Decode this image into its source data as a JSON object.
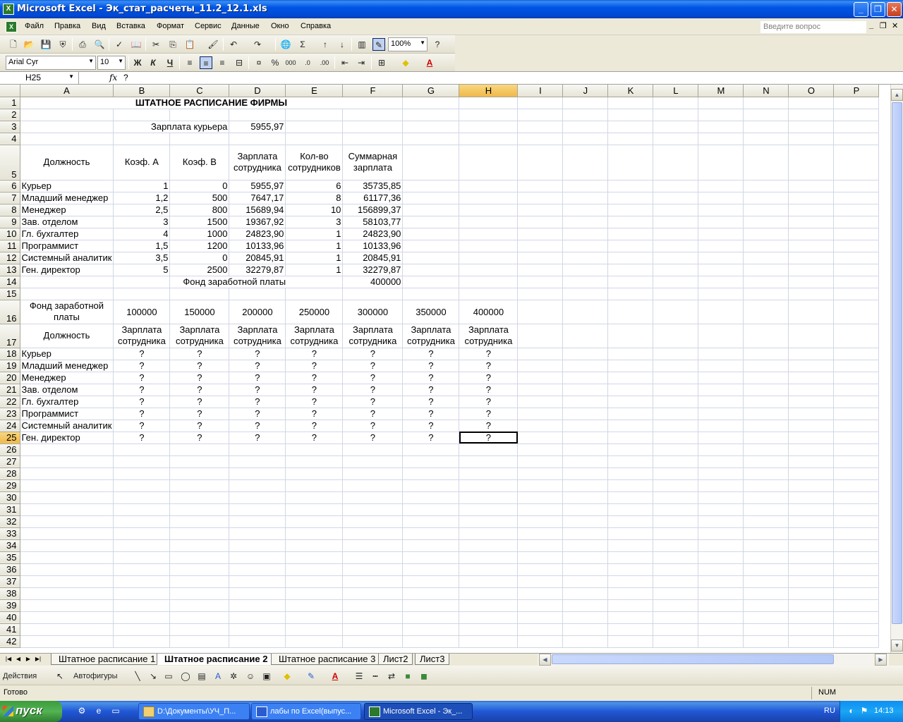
{
  "window": {
    "title": "Microsoft Excel - Эк_стат_расчеты_11.2_12.1.xls",
    "app_icon": "excel-icon"
  },
  "menu": {
    "items": [
      "Файл",
      "Правка",
      "Вид",
      "Вставка",
      "Формат",
      "Сервис",
      "Данные",
      "Окно",
      "Справка"
    ],
    "help_placeholder": "Введите вопрос"
  },
  "toolbar": {
    "zoom": "100%",
    "font_name": "Arial Cyr",
    "font_size": "10",
    "bold": "Ж",
    "italic": "К",
    "underline": "Ч",
    "percent": "%",
    "thousands": "000"
  },
  "formula_bar": {
    "name_box": "H25",
    "fx": "fx",
    "content": "?"
  },
  "columns": [
    "A",
    "B",
    "C",
    "D",
    "E",
    "F",
    "G",
    "H",
    "I",
    "J",
    "K",
    "L",
    "M",
    "N",
    "O",
    "P"
  ],
  "selected_column": "H",
  "selected_row": "25",
  "rows": {
    "r1": {
      "num": "1",
      "title": "ШТАТНОЕ РАСПИСАНИЕ ФИРМЫ"
    },
    "r2": {
      "num": "2"
    },
    "r3": {
      "num": "3",
      "label": "Зарплата курьера",
      "value": "5955,97"
    },
    "r4": {
      "num": "4"
    },
    "r5": {
      "num": "5",
      "h_pos": "Должность",
      "h_a": "Коэф. А",
      "h_b": "Коэф. В",
      "h_sal": "Зарплата сотрудника",
      "h_cnt": "Кол-во сотрудников",
      "h_sum": "Суммарная зарплата"
    },
    "staff": [
      {
        "num": "6",
        "pos": "Курьер",
        "a": "1",
        "b": "0",
        "sal": "5955,97",
        "cnt": "6",
        "sum": "35735,85"
      },
      {
        "num": "7",
        "pos": "Младший менеджер",
        "a": "1,2",
        "b": "500",
        "sal": "7647,17",
        "cnt": "8",
        "sum": "61177,36"
      },
      {
        "num": "8",
        "pos": "Менеджер",
        "a": "2,5",
        "b": "800",
        "sal": "15689,94",
        "cnt": "10",
        "sum": "156899,37"
      },
      {
        "num": "9",
        "pos": "Зав. отделом",
        "a": "3",
        "b": "1500",
        "sal": "19367,92",
        "cnt": "3",
        "sum": "58103,77"
      },
      {
        "num": "10",
        "pos": "Гл. бухгалтер",
        "a": "4",
        "b": "1000",
        "sal": "24823,90",
        "cnt": "1",
        "sum": "24823,90"
      },
      {
        "num": "11",
        "pos": "Программист",
        "a": "1,5",
        "b": "1200",
        "sal": "10133,96",
        "cnt": "1",
        "sum": "10133,96"
      },
      {
        "num": "12",
        "pos": "Системный аналитик",
        "a": "3,5",
        "b": "0",
        "sal": "20845,91",
        "cnt": "1",
        "sum": "20845,91"
      },
      {
        "num": "13",
        "pos": "Ген. директор",
        "a": "5",
        "b": "2500",
        "sal": "32279,87",
        "cnt": "1",
        "sum": "32279,87"
      }
    ],
    "r14": {
      "num": "14",
      "label": "Фонд заработной платы",
      "value": "400000"
    },
    "r15": {
      "num": "15"
    },
    "r16": {
      "num": "16",
      "label": "Фонд заработной платы",
      "funds": [
        "100000",
        "150000",
        "200000",
        "250000",
        "300000",
        "350000",
        "400000"
      ]
    },
    "r17": {
      "num": "17",
      "label": "Должность",
      "head": "Зарплата сотрудника"
    },
    "matrix": [
      {
        "num": "18",
        "pos": "Курьер",
        "vals": [
          "?",
          "?",
          "?",
          "?",
          "?",
          "?",
          "?"
        ]
      },
      {
        "num": "19",
        "pos": "Младший менеджер",
        "vals": [
          "?",
          "?",
          "?",
          "?",
          "?",
          "?",
          "?"
        ]
      },
      {
        "num": "20",
        "pos": "Менеджер",
        "vals": [
          "?",
          "?",
          "?",
          "?",
          "?",
          "?",
          "?"
        ]
      },
      {
        "num": "21",
        "pos": "Зав. отделом",
        "vals": [
          "?",
          "?",
          "?",
          "?",
          "?",
          "?",
          "?"
        ]
      },
      {
        "num": "22",
        "pos": "Гл. бухгалтер",
        "vals": [
          "?",
          "?",
          "?",
          "?",
          "?",
          "?",
          "?"
        ]
      },
      {
        "num": "23",
        "pos": "Программист",
        "vals": [
          "?",
          "?",
          "?",
          "?",
          "?",
          "?",
          "?"
        ]
      },
      {
        "num": "24",
        "pos": "Системный аналитик",
        "vals": [
          "?",
          "?",
          "?",
          "?",
          "?",
          "?",
          "?"
        ]
      },
      {
        "num": "25",
        "pos": "Ген. директор",
        "vals": [
          "?",
          "?",
          "?",
          "?",
          "?",
          "?",
          "?"
        ]
      }
    ],
    "empty": [
      "26",
      "27",
      "28",
      "29",
      "30",
      "31",
      "32",
      "33",
      "34",
      "35",
      "36",
      "37",
      "38",
      "39",
      "40",
      "41",
      "42"
    ]
  },
  "sheet_tabs": [
    "Штатное расписание 1",
    "Штатное расписание 2",
    "Штатное расписание 3",
    "Лист2",
    "Лист3"
  ],
  "active_tab": "Штатное расписание 2",
  "drawing_toolbar": {
    "actions": "Действия",
    "autoshapes": "Автофигуры"
  },
  "status": {
    "ready": "Готово",
    "num": "NUM"
  },
  "taskbar": {
    "start": "пуск",
    "tasks": [
      "D:\\Документы\\УЧ_П...",
      "лабы по Excel(выпус...",
      "Microsoft Excel - Эк_..."
    ],
    "lang": "RU",
    "clock": "14:13"
  }
}
